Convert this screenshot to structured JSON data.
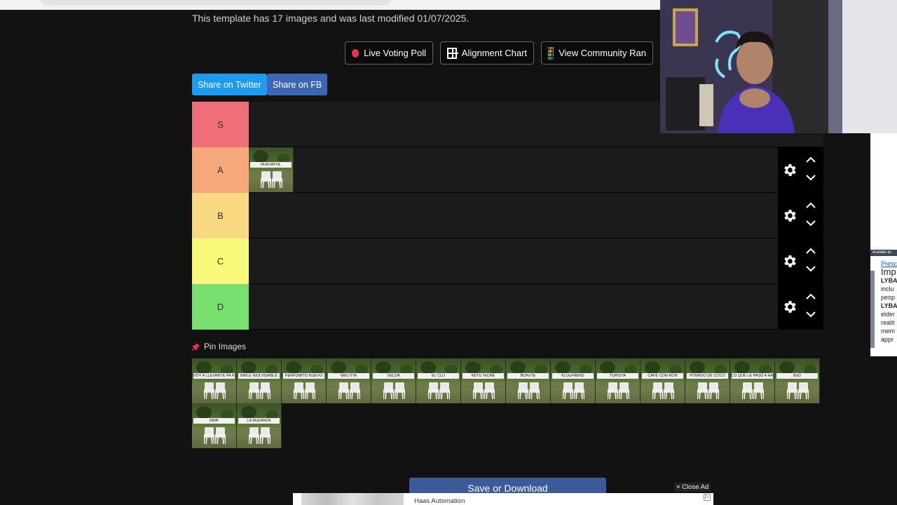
{
  "header": {
    "info_text": "This template has 17 images and was last modified 01/07/2025."
  },
  "actions": {
    "live_voting_label": "Live Voting Poll",
    "alignment_chart_label": "Alignment Chart",
    "community_rank_label": "View Community Ran"
  },
  "share": {
    "twitter_label": "Share on Twitter",
    "fb_label": "Share on FB"
  },
  "tiers": [
    {
      "label": "S",
      "color": "#ef6e78"
    },
    {
      "label": "A",
      "color": "#f6a87c",
      "items": [
        "NUEVAYOL"
      ]
    },
    {
      "label": "B",
      "color": "#f8d880"
    },
    {
      "label": "C",
      "color": "#f8f879"
    },
    {
      "label": "D",
      "color": "#79e06f"
    }
  ],
  "pin": {
    "label": "Pin Images"
  },
  "pool_items": [
    "VOY A LLEVARTE PA PR",
    "BAILE INOLVIDABLE",
    "PERFUMITO NUEVO",
    "WELTITA",
    "VELDÁ",
    "EL CLÚ",
    "KETU TeCRÉ",
    "BOKeTE",
    "KLOuFRENS",
    "TURISTA",
    "CAFÉ CON RON",
    "PIToROO DE COCO",
    "LO QUE LE PASÓ A HAWAii",
    "BoD",
    "DtMF",
    "LA MuDANZA"
  ],
  "footer": {
    "save_label": "Save or Download",
    "close_ad_label": "× Close Ad",
    "bottom_ad_text": "Haas Automation"
  },
  "side_ad": {
    "available_tag": "Available by",
    "lines": [
      "Presc",
      "Imp",
      "LYBA",
      "inclu",
      "peop",
      "LYBA",
      "elder",
      "realit",
      "mem",
      "appr"
    ]
  },
  "colors": {
    "twitter": "#1d9bf0",
    "facebook": "#3d67b5",
    "save_button": "#3a5a9a",
    "live_dot": "#e8334d"
  }
}
